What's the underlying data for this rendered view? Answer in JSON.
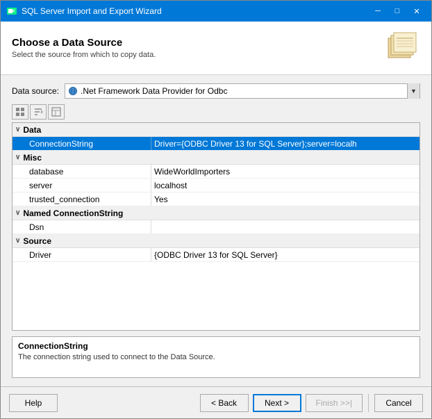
{
  "window": {
    "title": "SQL Server Import and Export Wizard",
    "controls": {
      "minimize": "─",
      "maximize": "□",
      "close": "✕"
    }
  },
  "header": {
    "title": "Choose a Data Source",
    "subtitle": "Select the source from which to copy data."
  },
  "datasource": {
    "label": "Data source:",
    "value": ".Net Framework Data Provider for Odbc",
    "dropdown_arrow": "▼"
  },
  "toolbar": {
    "btn1": "≡",
    "btn2": "↕",
    "btn3": "□"
  },
  "properties": {
    "groups": [
      {
        "name": "Data",
        "collapsed": false,
        "rows": [
          {
            "key": "ConnectionString",
            "value": "Driver={ODBC Driver 13 for SQL Server};server=localh",
            "selected": true
          }
        ]
      },
      {
        "name": "Misc",
        "collapsed": false,
        "rows": [
          {
            "key": "database",
            "value": "WideWorldImporters",
            "selected": false
          },
          {
            "key": "server",
            "value": "localhost",
            "selected": false
          },
          {
            "key": "trusted_connection",
            "value": "Yes",
            "selected": false
          }
        ]
      },
      {
        "name": "Named ConnectionString",
        "collapsed": false,
        "rows": [
          {
            "key": "Dsn",
            "value": "",
            "selected": false
          }
        ]
      },
      {
        "name": "Source",
        "collapsed": false,
        "rows": [
          {
            "key": "Driver",
            "value": "{ODBC Driver 13 for SQL Server}",
            "selected": false
          }
        ]
      }
    ]
  },
  "info": {
    "title": "ConnectionString",
    "description": "The connection string used to connect to the Data Source."
  },
  "footer": {
    "help": "Help",
    "back": "< Back",
    "next": "Next >",
    "finish": "Finish >>|",
    "cancel": "Cancel"
  },
  "colors": {
    "accent": "#0078d7",
    "selected_bg": "#0078d7",
    "selected_text": "#ffffff"
  }
}
